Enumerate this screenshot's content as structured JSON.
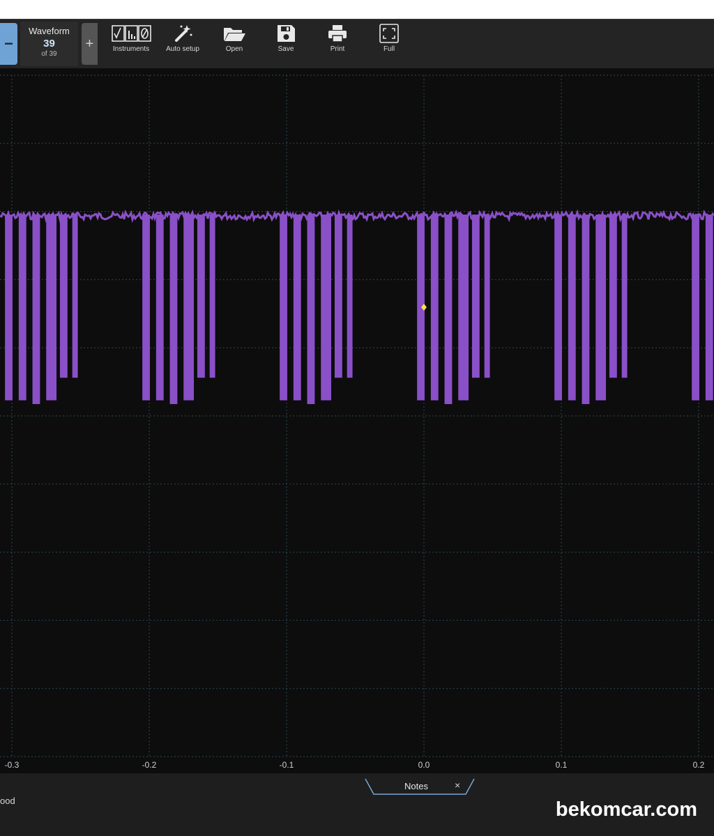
{
  "toolbar": {
    "waveform": {
      "title": "Waveform",
      "current": "39",
      "of_text": "of 39"
    },
    "buttons": [
      {
        "label": "Instruments",
        "icon": "instruments-icon"
      },
      {
        "label": "Auto setup",
        "icon": "auto-setup-wand-icon"
      },
      {
        "label": "Open",
        "icon": "folder-open-icon"
      },
      {
        "label": "Save",
        "icon": "floppy-disk-icon"
      },
      {
        "label": "Print",
        "icon": "printer-icon"
      },
      {
        "label": "Full",
        "icon": "fullscreen-icon"
      }
    ]
  },
  "chart_data": {
    "type": "line",
    "x_tick_labels": [
      "-0.3",
      "-0.2",
      "-0.1",
      "0.0",
      "0.1",
      "0.2"
    ],
    "xlim": [
      -0.31,
      0.21
    ],
    "grid": true,
    "trace_color": "#8a50c8",
    "marker_color": "#ffe14a",
    "marker_x": 0.0,
    "burst_starts": [
      -0.305,
      -0.205,
      -0.105,
      -0.005,
      0.095,
      0.195
    ],
    "burst_pulses": [
      {
        "offset": 0.0,
        "width": 0.0055,
        "depth": 0.98
      },
      {
        "offset": 0.01,
        "width": 0.0055,
        "depth": 0.98
      },
      {
        "offset": 0.02,
        "width": 0.0055,
        "depth": 1.0
      },
      {
        "offset": 0.03,
        "width": 0.0075,
        "depth": 0.98
      },
      {
        "offset": 0.04,
        "width": 0.0055,
        "depth": 0.86
      },
      {
        "offset": 0.049,
        "width": 0.004,
        "depth": 0.86
      }
    ]
  },
  "status": {
    "left_text": "ood",
    "notes_label": "Notes",
    "notes_close": "×"
  },
  "watermark": "bekomcar.com"
}
